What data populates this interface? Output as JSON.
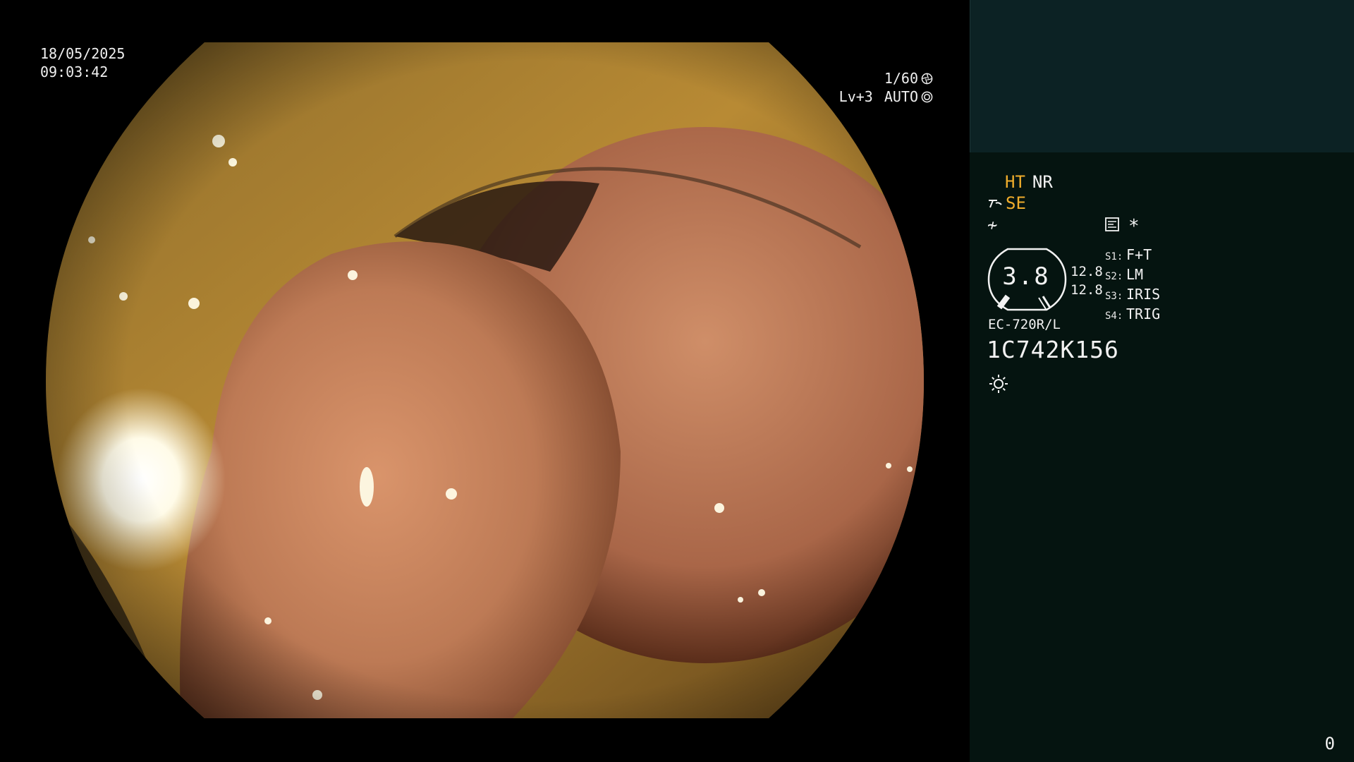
{
  "video": {
    "date": "18/05/2025",
    "time": "09:03:42",
    "shutter": "1/60",
    "shutter_icon": "aperture-icon",
    "level": "Lv+3",
    "exposure_mode": "AUTO",
    "exposure_icon": "auto-exposure-icon"
  },
  "panel": {
    "mode_ht": "HT",
    "mode_nr": "NR",
    "mode_se": "SE",
    "mode_symbol": "≁",
    "star": "*",
    "gauge_value": "3.8",
    "num_top": "12.8",
    "num_bottom": "12.8",
    "switches": [
      {
        "key": "S1:",
        "value": "F+T"
      },
      {
        "key": "S2:",
        "value": "LM"
      },
      {
        "key": "S3:",
        "value": "IRIS"
      },
      {
        "key": "S4:",
        "value": "TRIG"
      }
    ],
    "model": "EC-720R/L",
    "serial": "1C742K156",
    "counter": "0"
  },
  "colors": {
    "panel_bg": "#051410",
    "panel_top_bg": "#0c2224",
    "accent_amber": "#f0ad2c",
    "text": "#f2f2f2"
  }
}
